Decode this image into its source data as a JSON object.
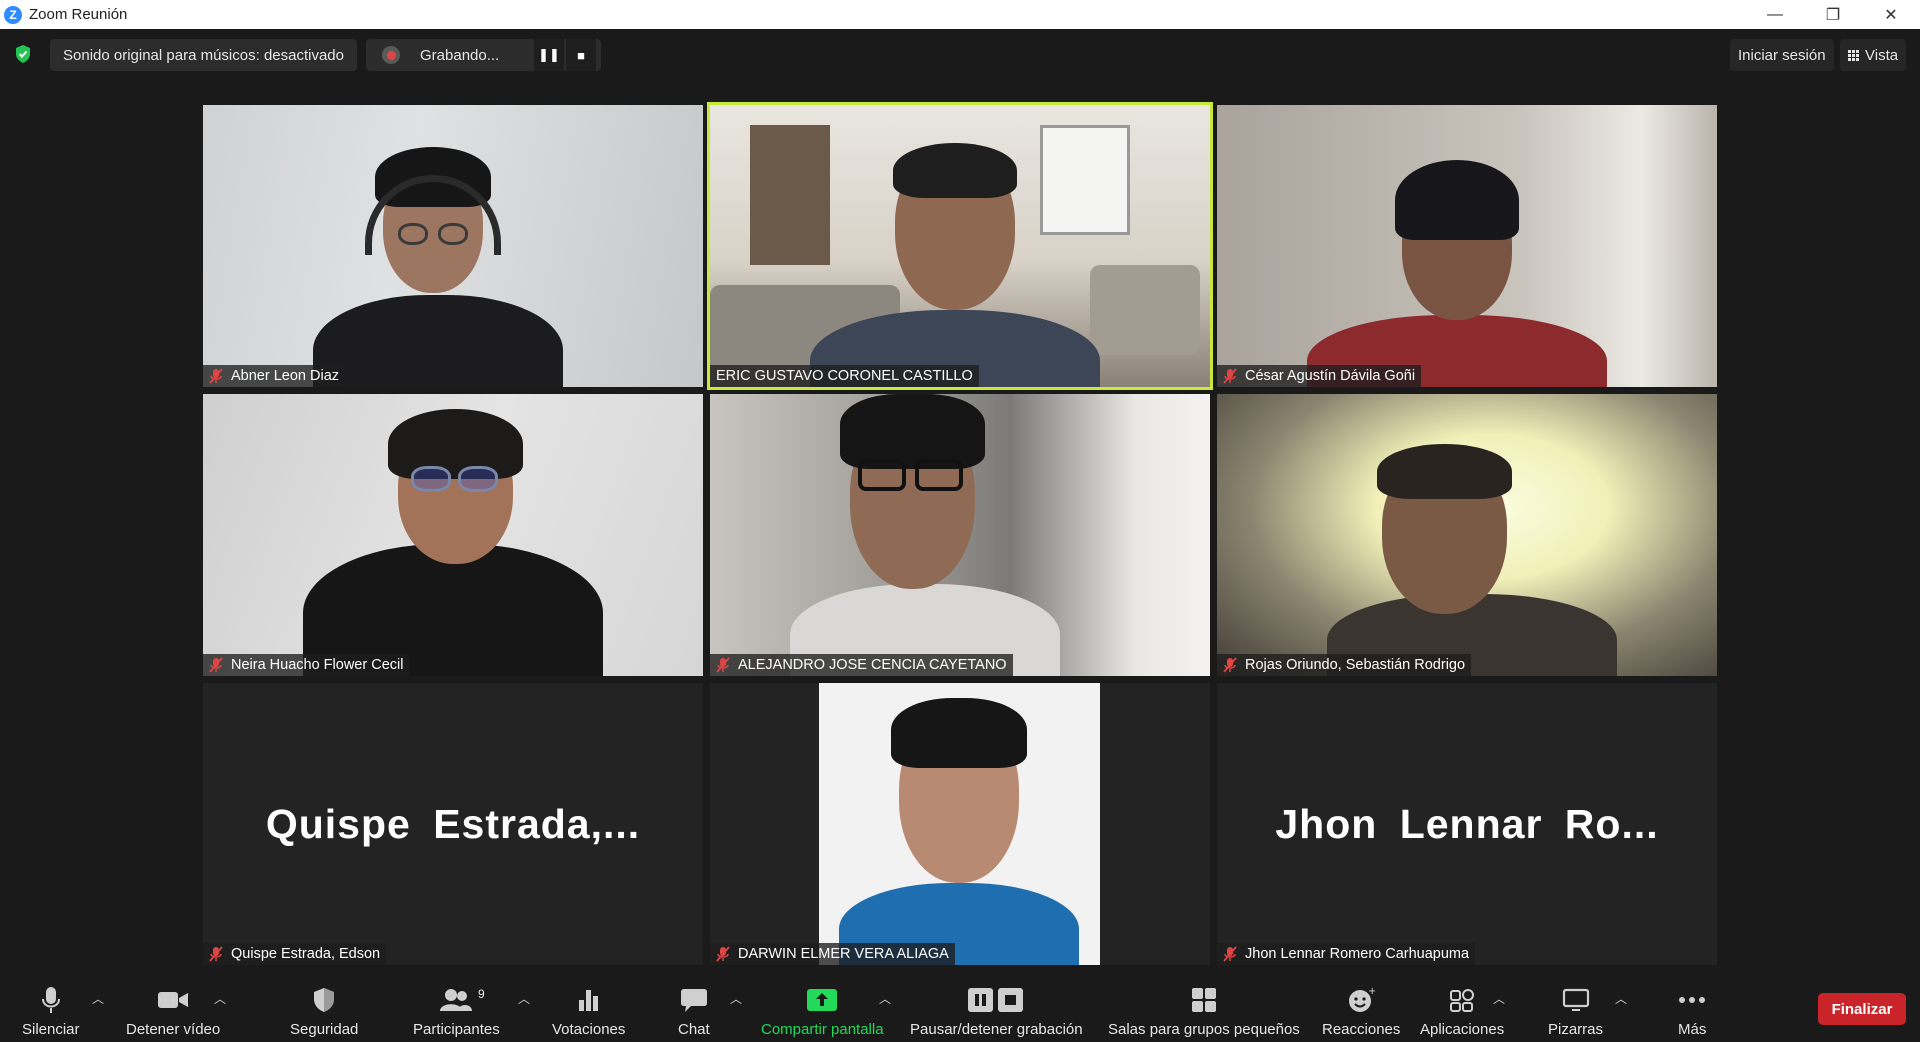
{
  "window": {
    "title": "Zoom Reunión",
    "minimize": "—",
    "restore": "❐",
    "close": "✕"
  },
  "topbar": {
    "original_sound": "Sonido original para músicos: desactivado",
    "recording_label": "Grabando...",
    "pause_glyph": "❚❚",
    "stop_glyph": "■",
    "signin": "Iniciar sesión",
    "view": "Vista"
  },
  "participants": [
    {
      "name": "Abner Leon Diaz",
      "video": true
    },
    {
      "name": "ERIC GUSTAVO CORONEL CASTILLO",
      "video": true,
      "active_speaker": true
    },
    {
      "name": "César Agustín Dávila Goñi",
      "video": true
    },
    {
      "name": "Neira Huacho Flower Cecil",
      "video": true
    },
    {
      "name": "ALEJANDRO JOSE CENCIA CAYETANO",
      "video": true
    },
    {
      "name": "Rojas Oriundo, Sebastián Rodrigo",
      "video": true
    },
    {
      "name": "Quispe Estrada, Edson",
      "video": false,
      "display_name": "Quispe  Estrada,..."
    },
    {
      "name": "DARWIN ELMER VERA ALIAGA",
      "video": true
    },
    {
      "name": "Jhon Lennar Romero Carhuapuma",
      "video": false,
      "display_name": "Jhon  Lennar  Ro..."
    }
  ],
  "toolbar": {
    "mute": "Silenciar",
    "stop_video": "Detener vídeo",
    "security": "Seguridad",
    "participants": "Participantes",
    "participants_count": "9",
    "polls": "Votaciones",
    "chat": "Chat",
    "share_screen": "Compartir pantalla",
    "pause_recording": "Pausar/detener grabación",
    "breakout_rooms": "Salas para grupos pequeños",
    "reactions": "Reacciones",
    "apps": "Aplicaciones",
    "whiteboards": "Pizarras",
    "more": "Más",
    "end": "Finalizar"
  },
  "colors": {
    "active_speaker_border": "#c8e83c",
    "share_green": "#23d959",
    "end_red": "#c8242a",
    "mic_off_red": "#e04545"
  }
}
